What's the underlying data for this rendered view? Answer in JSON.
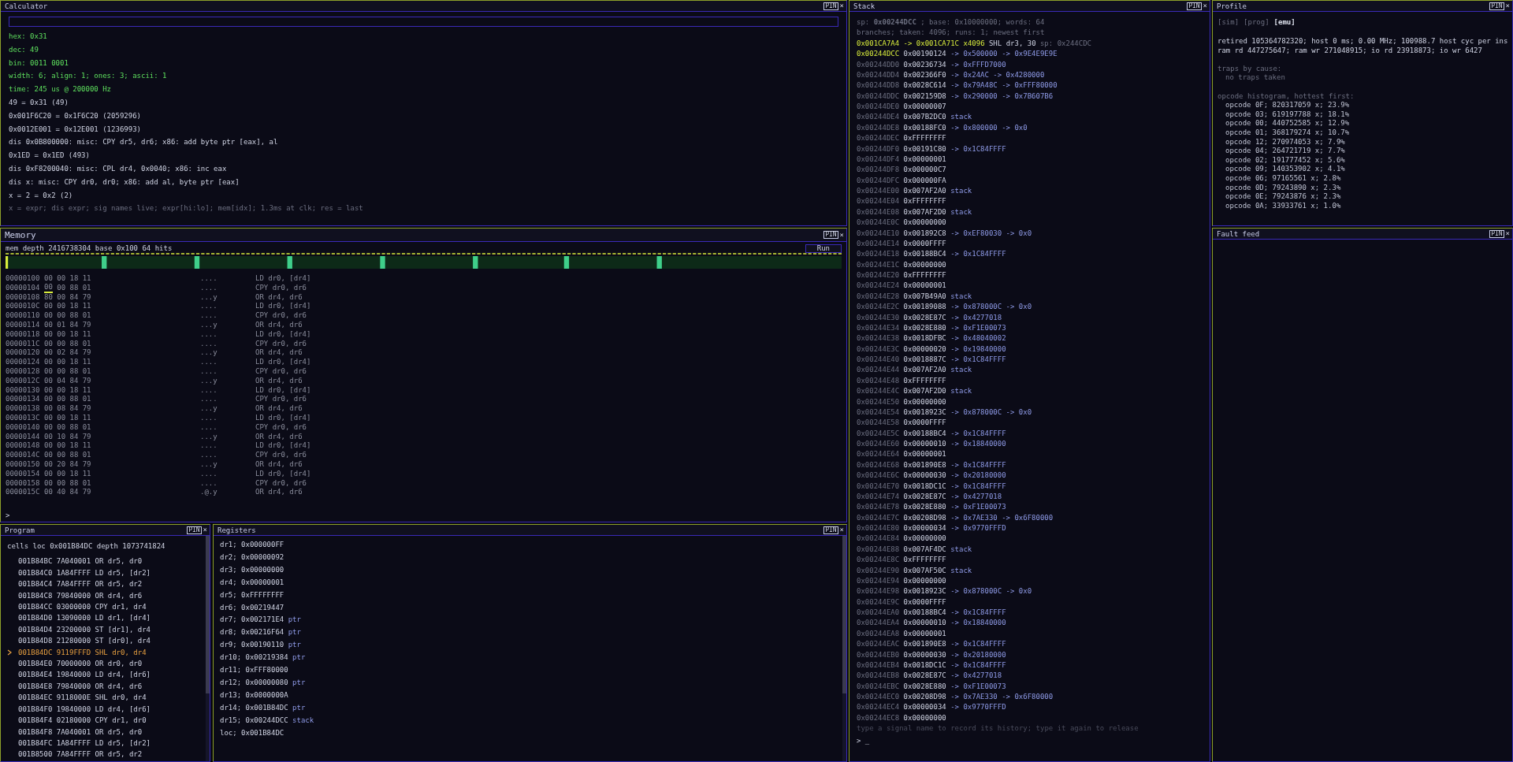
{
  "calculator": {
    "title": "Calculator",
    "pin": "PIN",
    "close": "×",
    "lines": [
      {
        "kind": "result",
        "text": "hex: 0x31"
      },
      {
        "kind": "result",
        "text": "dec: 49"
      },
      {
        "kind": "result",
        "text": "bin: 0011 0001"
      },
      {
        "kind": "result",
        "text": "width: 6; align: 1; ones: 3; ascii: 1"
      },
      {
        "kind": "result",
        "text": "time: 245 us @ 200000 Hz"
      },
      {
        "kind": "plain",
        "text": "49 = 0x31 (49)"
      },
      {
        "kind": "plain",
        "text": "0x001F6C20 = 0x1F6C20 (2059296)"
      },
      {
        "kind": "plain",
        "text": "0x0012E001 = 0x12E001 (1236993)"
      },
      {
        "kind": "plain",
        "text": "dis 0x0B800000: misc: CPY dr5, dr6; x86: add byte ptr [eax], al"
      },
      {
        "kind": "plain",
        "text": "0x1ED = 0x1ED (493)"
      },
      {
        "kind": "plain",
        "text": "dis 0xF8200040: misc: CPL dr4, 0x0040; x86: inc eax"
      },
      {
        "kind": "plain",
        "text": "dis x: misc: CPY dr0, dr0; x86: add al, byte ptr [eax]"
      },
      {
        "kind": "plain",
        "text": "x = 2 = 0x2 (2)"
      },
      {
        "kind": "hint",
        "text": "x = expr; dis expr; sig names live; expr[hi:lo]; mem[idx]; 1.3ms at clk; res = last"
      }
    ]
  },
  "memory": {
    "title": "Memory",
    "pin": "PIN",
    "close": "×",
    "summary": "mem depth 2416738304 base 0x100 64 hits",
    "run": "Run",
    "prompt": ">",
    "rows": [
      {
        "addr": "00000100",
        "bytes": [
          "00",
          "00",
          "18",
          "11"
        ],
        "ascii": "....",
        "disasm": "LD dr0, [dr4]",
        "cursor": false
      },
      {
        "addr": "00000104",
        "bytes": [
          "00",
          "00",
          "88",
          "01"
        ],
        "ascii": "....",
        "disasm": "CPY dr0, dr6",
        "cursor": true
      },
      {
        "addr": "00000108",
        "bytes": [
          "80",
          "00",
          "84",
          "79"
        ],
        "ascii": "...y",
        "disasm": "OR dr4, dr6",
        "cursor": false
      },
      {
        "addr": "0000010C",
        "bytes": [
          "00",
          "00",
          "18",
          "11"
        ],
        "ascii": "....",
        "disasm": "LD dr0, [dr4]",
        "cursor": false
      },
      {
        "addr": "00000110",
        "bytes": [
          "00",
          "00",
          "88",
          "01"
        ],
        "ascii": "....",
        "disasm": "CPY dr0, dr6",
        "cursor": false
      },
      {
        "addr": "00000114",
        "bytes": [
          "00",
          "01",
          "84",
          "79"
        ],
        "ascii": "...y",
        "disasm": "OR dr4, dr6",
        "cursor": false
      },
      {
        "addr": "00000118",
        "bytes": [
          "00",
          "00",
          "18",
          "11"
        ],
        "ascii": "....",
        "disasm": "LD dr0, [dr4]",
        "cursor": false
      },
      {
        "addr": "0000011C",
        "bytes": [
          "00",
          "00",
          "88",
          "01"
        ],
        "ascii": "....",
        "disasm": "CPY dr0, dr6",
        "cursor": false
      },
      {
        "addr": "00000120",
        "bytes": [
          "00",
          "02",
          "84",
          "79"
        ],
        "ascii": "...y",
        "disasm": "OR dr4, dr6",
        "cursor": false
      },
      {
        "addr": "00000124",
        "bytes": [
          "00",
          "00",
          "18",
          "11"
        ],
        "ascii": "....",
        "disasm": "LD dr0, [dr4]",
        "cursor": false
      },
      {
        "addr": "00000128",
        "bytes": [
          "00",
          "00",
          "88",
          "01"
        ],
        "ascii": "....",
        "disasm": "CPY dr0, dr6",
        "cursor": false
      },
      {
        "addr": "0000012C",
        "bytes": [
          "00",
          "04",
          "84",
          "79"
        ],
        "ascii": "...y",
        "disasm": "OR dr4, dr6",
        "cursor": false
      },
      {
        "addr": "00000130",
        "bytes": [
          "00",
          "00",
          "18",
          "11"
        ],
        "ascii": "....",
        "disasm": "LD dr0, [dr4]",
        "cursor": false
      },
      {
        "addr": "00000134",
        "bytes": [
          "00",
          "00",
          "88",
          "01"
        ],
        "ascii": "....",
        "disasm": "CPY dr0, dr6",
        "cursor": false
      },
      {
        "addr": "00000138",
        "bytes": [
          "00",
          "08",
          "84",
          "79"
        ],
        "ascii": "...y",
        "disasm": "OR dr4, dr6",
        "cursor": false
      },
      {
        "addr": "0000013C",
        "bytes": [
          "00",
          "00",
          "18",
          "11"
        ],
        "ascii": "....",
        "disasm": "LD dr0, [dr4]",
        "cursor": false
      },
      {
        "addr": "00000140",
        "bytes": [
          "00",
          "00",
          "88",
          "01"
        ],
        "ascii": "....",
        "disasm": "CPY dr0, dr6",
        "cursor": false
      },
      {
        "addr": "00000144",
        "bytes": [
          "00",
          "10",
          "84",
          "79"
        ],
        "ascii": "...y",
        "disasm": "OR dr4, dr6",
        "cursor": false
      },
      {
        "addr": "00000148",
        "bytes": [
          "00",
          "00",
          "18",
          "11"
        ],
        "ascii": "....",
        "disasm": "LD dr0, [dr4]",
        "cursor": false
      },
      {
        "addr": "0000014C",
        "bytes": [
          "00",
          "00",
          "88",
          "01"
        ],
        "ascii": "....",
        "disasm": "CPY dr0, dr6",
        "cursor": false
      },
      {
        "addr": "00000150",
        "bytes": [
          "00",
          "20",
          "84",
          "79"
        ],
        "ascii": "...y",
        "disasm": "OR dr4, dr6",
        "cursor": false
      },
      {
        "addr": "00000154",
        "bytes": [
          "00",
          "00",
          "18",
          "11"
        ],
        "ascii": "....",
        "disasm": "LD dr0, [dr4]",
        "cursor": false
      },
      {
        "addr": "00000158",
        "bytes": [
          "00",
          "00",
          "88",
          "01"
        ],
        "ascii": "....",
        "disasm": "CPY dr0, dr6",
        "cursor": false
      },
      {
        "addr": "0000015C",
        "bytes": [
          "00",
          "40",
          "84",
          "79"
        ],
        "ascii": ".@.y",
        "disasm": "OR dr4, dr6",
        "cursor": false
      }
    ]
  },
  "program": {
    "title": "Program",
    "pin": "PIN",
    "close": "×",
    "summary": "cells loc 0x001B84DC depth 1073741824",
    "rows": [
      {
        "addr": "001B84BC",
        "word": "7A040001",
        "instr": "OR dr5, dr0",
        "current": false
      },
      {
        "addr": "001B84C0",
        "word": "1A84FFFF",
        "instr": "LD dr5, [dr2]",
        "current": false
      },
      {
        "addr": "001B84C4",
        "word": "7A84FFFF",
        "instr": "OR dr5, dr2",
        "current": false
      },
      {
        "addr": "001B84C8",
        "word": "79840000",
        "instr": "OR dr4, dr6",
        "current": false
      },
      {
        "addr": "001B84CC",
        "word": "03000000",
        "instr": "CPY dr1, dr4",
        "current": false
      },
      {
        "addr": "001B84D0",
        "word": "13090000",
        "instr": "LD dr1, [dr4]",
        "current": false
      },
      {
        "addr": "001B84D4",
        "word": "23200000",
        "instr": "ST [dr1], dr4",
        "current": false
      },
      {
        "addr": "001B84D8",
        "word": "21280000",
        "instr": "ST [dr0], dr4",
        "current": false
      },
      {
        "addr": "001B84DC",
        "word": "9119FFFD",
        "instr": "SHL dr0, dr4",
        "current": true
      },
      {
        "addr": "001B84E0",
        "word": "70000000",
        "instr": "OR dr0, dr0",
        "current": false
      },
      {
        "addr": "001B84E4",
        "word": "19840000",
        "instr": "LD dr4, [dr6]",
        "current": false
      },
      {
        "addr": "001B84E8",
        "word": "79840000",
        "instr": "OR dr4, dr6",
        "current": false
      },
      {
        "addr": "001B84EC",
        "word": "9118000E",
        "instr": "SHL dr0, dr4",
        "current": false
      },
      {
        "addr": "001B84F0",
        "word": "19840000",
        "instr": "LD dr4, [dr6]",
        "current": false
      },
      {
        "addr": "001B84F4",
        "word": "02180000",
        "instr": "CPY dr1, dr0",
        "current": false
      },
      {
        "addr": "001B84F8",
        "word": "7A040001",
        "instr": "OR dr5, dr0",
        "current": false
      },
      {
        "addr": "001B84FC",
        "word": "1A84FFFF",
        "instr": "LD dr5, [dr2]",
        "current": false
      },
      {
        "addr": "001B8500",
        "word": "7A84FFFF",
        "instr": "OR dr5, dr2",
        "current": false
      }
    ]
  },
  "registers": {
    "title": "Registers",
    "pin": "PIN",
    "close": "×",
    "rows": [
      {
        "text": "dr1; 0x000000FF"
      },
      {
        "text": "dr2; 0x00000092"
      },
      {
        "text": "dr3; 0x00000000"
      },
      {
        "text": "dr4; 0x00000001"
      },
      {
        "text": "dr5; 0xFFFFFFFF"
      },
      {
        "text": "dr6; 0x00219447"
      },
      {
        "text": "dr7; 0x002171E4",
        "tag": "ptr"
      },
      {
        "text": "dr8; 0x00216F64",
        "tag": "ptr"
      },
      {
        "text": "dr9; 0x00190110",
        "tag": "ptr"
      },
      {
        "text": "dr10; 0x00219384",
        "tag": "ptr"
      },
      {
        "text": "dr11; 0xFFF80000"
      },
      {
        "text": "dr12; 0x00000080",
        "tag": "ptr"
      },
      {
        "text": "dr13; 0x0000000A"
      },
      {
        "text": "dr14; 0x001B84DC",
        "tag": "ptr"
      },
      {
        "text": "dr15; 0x00244DCC",
        "tag": "stack"
      },
      {
        "text": "loc; 0x001B84DC"
      }
    ]
  },
  "stack": {
    "title": "Stack",
    "pin": "PIN",
    "close": "×",
    "summary": "sp: **0x00244DCC**; base: 0x10000000; words: 64",
    "branches": "branches; taken: 4096; runs: 1; newest first",
    "branch": {
      "jump": "0x001CA7A4 -> 0x001CA71C x4096",
      "instr": "SHL dr3, 30",
      "sp": "sp: 0x244CDC"
    },
    "rows": [
      {
        "addr": "0x00244DCC",
        "value": "0x00190124",
        "chain": "-> 0x500000 -> 0x9E4E9E9E",
        "sp": true
      },
      {
        "addr": "0x00244DD0",
        "value": "0x00236734",
        "chain": "-> 0xFFFD7000",
        "sp": false
      },
      {
        "addr": "0x00244DD4",
        "value": "0x002366F0",
        "chain": "-> 0x24AC -> 0x4280000",
        "sp": false
      },
      {
        "addr": "0x00244DD8",
        "value": "0x0028C614",
        "chain": "-> 0x79A48C -> 0xFFF80000",
        "sp": false
      },
      {
        "addr": "0x00244DDC",
        "value": "0x002159D8",
        "chain": "-> 0x290000 -> 0x7B607B6",
        "sp": false
      },
      {
        "addr": "0x00244DE0",
        "value": "0x00000007",
        "sp": false
      },
      {
        "addr": "0x00244DE4",
        "value": "0x007B2DC0",
        "chain": "stack",
        "sp": false
      },
      {
        "addr": "0x00244DE8",
        "value": "0x00188FC0",
        "chain": "-> 0x800000 -> 0x0",
        "sp": false
      },
      {
        "addr": "0x00244DEC",
        "value": "0xFFFFFFFF",
        "sp": false
      },
      {
        "addr": "0x00244DF0",
        "value": "0x00191C80",
        "chain": "-> 0x1C84FFFF",
        "sp": false
      },
      {
        "addr": "0x00244DF4",
        "value": "0x00000001",
        "sp": false
      },
      {
        "addr": "0x00244DF8",
        "value": "0x000000C7",
        "sp": false
      },
      {
        "addr": "0x00244DFC",
        "value": "0x000000FA",
        "sp": false
      },
      {
        "addr": "0x00244E00",
        "value": "0x007AF2A0",
        "chain": "stack",
        "sp": false
      },
      {
        "addr": "0x00244E04",
        "value": "0xFFFFFFFF",
        "sp": false
      },
      {
        "addr": "0x00244E08",
        "value": "0x007AF2D0",
        "chain": "stack",
        "sp": false
      },
      {
        "addr": "0x00244E0C",
        "value": "0x00000000",
        "sp": false
      },
      {
        "addr": "0x00244E10",
        "value": "0x001892C8",
        "chain": "-> 0xEF80030 -> 0x0",
        "sp": false
      },
      {
        "addr": "0x00244E14",
        "value": "0x0000FFFF",
        "sp": false
      },
      {
        "addr": "0x00244E18",
        "value": "0x00188BC4",
        "chain": "-> 0x1C84FFFF",
        "sp": false
      },
      {
        "addr": "0x00244E1C",
        "value": "0x00000000",
        "sp": false
      },
      {
        "addr": "0x00244E20",
        "value": "0xFFFFFFFF",
        "sp": false
      },
      {
        "addr": "0x00244E24",
        "value": "0x00000001",
        "sp": false
      },
      {
        "addr": "0x00244E28",
        "value": "0x007B49A0",
        "chain": "stack",
        "sp": false
      },
      {
        "addr": "0x00244E2C",
        "value": "0x00189088",
        "chain": "-> 0x878000C -> 0x0",
        "sp": false
      },
      {
        "addr": "0x00244E30",
        "value": "0x0028E87C",
        "chain": "-> 0x4277018",
        "sp": false
      },
      {
        "addr": "0x00244E34",
        "value": "0x0028E880",
        "chain": "-> 0xF1E00073",
        "sp": false
      },
      {
        "addr": "0x00244E38",
        "value": "0x0018DFBC",
        "chain": "-> 0x48040002",
        "sp": false
      },
      {
        "addr": "0x00244E3C",
        "value": "0x00000020",
        "chain": "-> 0x19840000",
        "sp": false
      },
      {
        "addr": "0x00244E40",
        "value": "0x0018887C",
        "chain": "-> 0x1C84FFFF",
        "sp": false
      },
      {
        "addr": "0x00244E44",
        "value": "0x007AF2A0",
        "chain": "stack",
        "sp": false
      },
      {
        "addr": "0x00244E48",
        "value": "0xFFFFFFFF",
        "sp": false
      },
      {
        "addr": "0x00244E4C",
        "value": "0x007AF2D0",
        "chain": "stack",
        "sp": false
      },
      {
        "addr": "0x00244E50",
        "value": "0x00000000",
        "sp": false
      },
      {
        "addr": "0x00244E54",
        "value": "0x0018923C",
        "chain": "-> 0x878000C -> 0x0",
        "sp": false
      },
      {
        "addr": "0x00244E58",
        "value": "0x0000FFFF",
        "sp": false
      },
      {
        "addr": "0x00244E5C",
        "value": "0x00188BC4",
        "chain": "-> 0x1C84FFFF",
        "sp": false
      },
      {
        "addr": "0x00244E60",
        "value": "0x00000010",
        "chain": "-> 0x18840000",
        "sp": false
      },
      {
        "addr": "0x00244E64",
        "value": "0x00000001",
        "sp": false
      },
      {
        "addr": "0x00244E68",
        "value": "0x001890E8",
        "chain": "-> 0x1C84FFFF",
        "sp": false
      },
      {
        "addr": "0x00244E6C",
        "value": "0x00000030",
        "chain": "-> 0x20180000",
        "sp": false
      },
      {
        "addr": "0x00244E70",
        "value": "0x0018DC1C",
        "chain": "-> 0x1C84FFFF",
        "sp": false
      },
      {
        "addr": "0x00244E74",
        "value": "0x0028E87C",
        "chain": "-> 0x4277018",
        "sp": false
      },
      {
        "addr": "0x00244E78",
        "value": "0x0028E880",
        "chain": "-> 0xF1E00073",
        "sp": false
      },
      {
        "addr": "0x00244E7C",
        "value": "0x00208D98",
        "chain": "-> 0x7AE330 -> 0x6F80000",
        "sp": false
      },
      {
        "addr": "0x00244E80",
        "value": "0x00000034",
        "chain": "-> 0x9770FFFD",
        "sp": false
      },
      {
        "addr": "0x00244E84",
        "value": "0x00000000",
        "sp": false
      },
      {
        "addr": "0x00244E88",
        "value": "0x007AF4DC",
        "chain": "stack",
        "sp": false
      },
      {
        "addr": "0x00244E8C",
        "value": "0xFFFFFFFF",
        "sp": false
      },
      {
        "addr": "0x00244E90",
        "value": "0x007AF50C",
        "chain": "stack",
        "sp": false
      },
      {
        "addr": "0x00244E94",
        "value": "0x00000000",
        "sp": false
      },
      {
        "addr": "0x00244E98",
        "value": "0x0018923C",
        "chain": "-> 0x878000C -> 0x0",
        "sp": false
      },
      {
        "addr": "0x00244E9C",
        "value": "0x0000FFFF",
        "sp": false
      },
      {
        "addr": "0x00244EA0",
        "value": "0x00188BC4",
        "chain": "-> 0x1C84FFFF",
        "sp": false
      },
      {
        "addr": "0x00244EA4",
        "value": "0x00000010",
        "chain": "-> 0x18840000",
        "sp": false
      },
      {
        "addr": "0x00244EA8",
        "value": "0x00000001",
        "sp": false
      },
      {
        "addr": "0x00244EAC",
        "value": "0x001890E8",
        "chain": "-> 0x1C84FFFF",
        "sp": false
      },
      {
        "addr": "0x00244EB0",
        "value": "0x00000030",
        "chain": "-> 0x20180000",
        "sp": false
      },
      {
        "addr": "0x00244EB4",
        "value": "0x0018DC1C",
        "chain": "-> 0x1C84FFFF",
        "sp": false
      },
      {
        "addr": "0x00244EB8",
        "value": "0x0028E87C",
        "chain": "-> 0x4277018",
        "sp": false
      },
      {
        "addr": "0x00244EBC",
        "value": "0x0028E880",
        "chain": "-> 0xF1E00073",
        "sp": false
      },
      {
        "addr": "0x00244EC0",
        "value": "0x00208D98",
        "chain": "-> 0x7AE330 -> 0x6F80000",
        "sp": false
      },
      {
        "addr": "0x00244EC4",
        "value": "0x00000034",
        "chain": "-> 0x9770FFFD",
        "sp": false
      },
      {
        "addr": "0x00244EC8",
        "value": "0x00000000",
        "sp": false
      }
    ],
    "hint": "type a signal name to record its history; type it again to release",
    "prompt": "> _"
  },
  "profile": {
    "title": "Profile",
    "pin": "PIN",
    "close": "×",
    "tabs": [
      {
        "label": "[sim]",
        "selected": false
      },
      {
        "label": "[prog]",
        "selected": false
      },
      {
        "label": "[emu]",
        "selected": true
      }
    ],
    "lines": [
      {
        "kind": "stat",
        "text": "retired 105364782320; host 0 ms; 0.00 MHz; 100988.7 host cyc per ins"
      },
      {
        "kind": "stat",
        "text": "ram rd 447275647; ram wr 271048915; io rd 23918873; io wr 6427"
      },
      {
        "kind": "gap"
      },
      {
        "kind": "heading",
        "text": "traps by cause:"
      },
      {
        "kind": "note",
        "text": "no traps taken"
      },
      {
        "kind": "gap"
      },
      {
        "kind": "heading",
        "text": "opcode histogram, hottest first:"
      },
      {
        "kind": "entry",
        "text": "opcode 0F; 820317059 x; 23.9%"
      },
      {
        "kind": "entry",
        "text": "opcode 03; 619197788 x; 18.1%"
      },
      {
        "kind": "entry",
        "text": "opcode 00; 440752585 x; 12.9%"
      },
      {
        "kind": "entry",
        "text": "opcode 01; 368179274 x; 10.7%"
      },
      {
        "kind": "entry",
        "text": "opcode 12; 270974053 x; 7.9%"
      },
      {
        "kind": "entry",
        "text": "opcode 04; 264721719 x; 7.7%"
      },
      {
        "kind": "entry",
        "text": "opcode 02; 191777452 x; 5.6%"
      },
      {
        "kind": "entry",
        "text": "opcode 09; 140353902 x; 4.1%"
      },
      {
        "kind": "entry",
        "text": "opcode 06; 97165561 x; 2.8%"
      },
      {
        "kind": "entry",
        "text": "opcode 0D; 79243890 x; 2.3%"
      },
      {
        "kind": "entry",
        "text": "opcode 0E; 79243876 x; 2.3%"
      },
      {
        "kind": "entry",
        "text": "opcode 0A; 33933761 x; 1.0%"
      }
    ]
  },
  "fault_feed": {
    "title": "Fault feed",
    "pin": "PIN",
    "close": "×"
  }
}
